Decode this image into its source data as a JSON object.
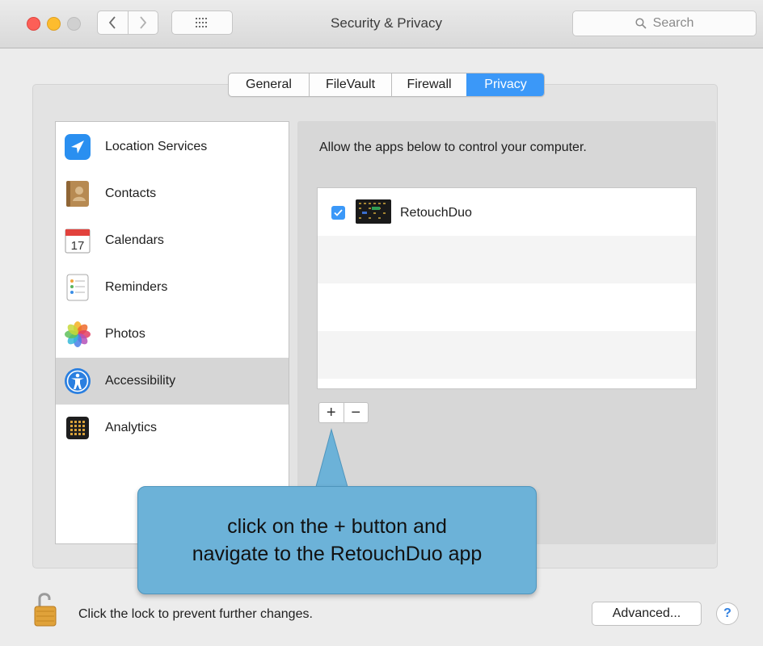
{
  "window": {
    "title": "Security & Privacy",
    "search_placeholder": "Search"
  },
  "tabs": [
    {
      "label": "General",
      "active": false
    },
    {
      "label": "FileVault",
      "active": false
    },
    {
      "label": "Firewall",
      "active": false
    },
    {
      "label": "Privacy",
      "active": true
    }
  ],
  "sidebar": {
    "items": [
      {
        "label": "Location Services",
        "icon": "location-arrow-icon",
        "selected": false
      },
      {
        "label": "Contacts",
        "icon": "contacts-book-icon",
        "selected": false
      },
      {
        "label": "Calendars",
        "icon": "calendar-icon",
        "selected": false
      },
      {
        "label": "Reminders",
        "icon": "reminders-list-icon",
        "selected": false
      },
      {
        "label": "Photos",
        "icon": "photos-flower-icon",
        "selected": false
      },
      {
        "label": "Accessibility",
        "icon": "accessibility-icon",
        "selected": true
      },
      {
        "label": "Analytics",
        "icon": "analytics-grid-icon",
        "selected": false
      }
    ],
    "calendar_day": "17"
  },
  "main": {
    "description": "Allow the apps below to control your computer.",
    "apps": [
      {
        "name": "RetouchDuo",
        "checked": true,
        "icon": "retouchduo-app-icon"
      }
    ],
    "add_label": "+",
    "remove_label": "−"
  },
  "callout": {
    "line1": "click on the + button and",
    "line2": "navigate to the RetouchDuo app",
    "color": "#6cb2d8"
  },
  "footer": {
    "lock_text": "Click the lock to prevent further changes.",
    "advanced_label": "Advanced...",
    "help_label": "?"
  },
  "colors": {
    "accent": "#3b98f8",
    "selection": "#d6d6d6"
  }
}
